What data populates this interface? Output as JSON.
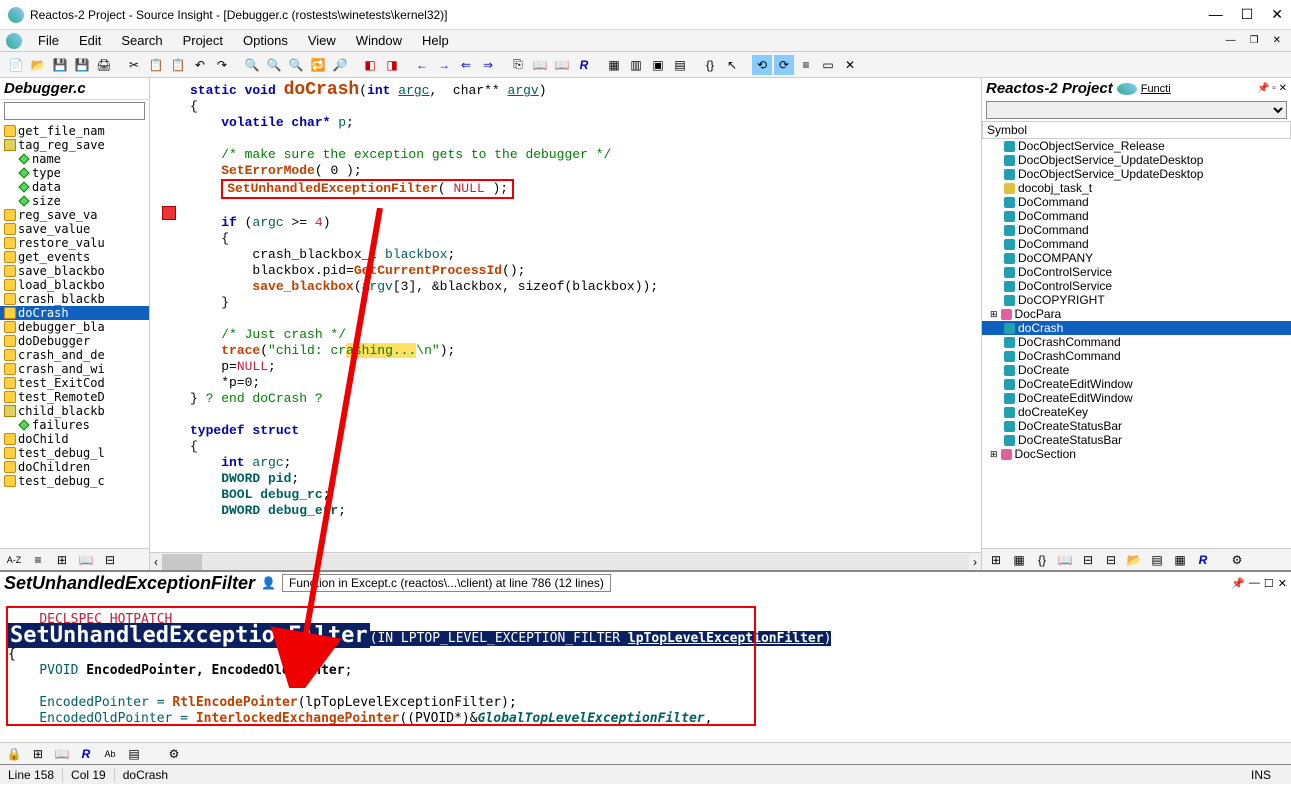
{
  "window": {
    "title": "Reactos-2 Project - Source Insight - [Debugger.c (rostests\\winetests\\kernel32)]"
  },
  "menu": {
    "items": [
      "File",
      "Edit",
      "Search",
      "Project",
      "Options",
      "View",
      "Window",
      "Help"
    ]
  },
  "left_pane": {
    "title": "Debugger.c",
    "symbols": [
      {
        "icon": "f",
        "indent": 0,
        "label": "get_file_nam"
      },
      {
        "icon": "s",
        "indent": 0,
        "label": "tag_reg_save"
      },
      {
        "icon": "m",
        "indent": 1,
        "label": "name"
      },
      {
        "icon": "m",
        "indent": 1,
        "label": "type"
      },
      {
        "icon": "m",
        "indent": 1,
        "label": "data"
      },
      {
        "icon": "m",
        "indent": 1,
        "label": "size"
      },
      {
        "icon": "f",
        "indent": 0,
        "label": "reg_save_va"
      },
      {
        "icon": "f",
        "indent": 0,
        "label": "save_value"
      },
      {
        "icon": "f",
        "indent": 0,
        "label": "restore_valu"
      },
      {
        "icon": "f",
        "indent": 0,
        "label": "get_events"
      },
      {
        "icon": "f",
        "indent": 0,
        "label": "save_blackbo"
      },
      {
        "icon": "f",
        "indent": 0,
        "label": "load_blackbo"
      },
      {
        "icon": "f",
        "indent": 0,
        "label": "crash_blackb"
      },
      {
        "icon": "f",
        "indent": 0,
        "label": "doCrash",
        "selected": true
      },
      {
        "icon": "f",
        "indent": 0,
        "label": "debugger_bla"
      },
      {
        "icon": "f",
        "indent": 0,
        "label": "doDebugger"
      },
      {
        "icon": "f",
        "indent": 0,
        "label": "crash_and_de"
      },
      {
        "icon": "f",
        "indent": 0,
        "label": "crash_and_wi"
      },
      {
        "icon": "f",
        "indent": 0,
        "label": "test_ExitCod"
      },
      {
        "icon": "f",
        "indent": 0,
        "label": "test_RemoteD"
      },
      {
        "icon": "s",
        "indent": 0,
        "label": "child_blackb"
      },
      {
        "icon": "m",
        "indent": 1,
        "label": "failures"
      },
      {
        "icon": "f",
        "indent": 0,
        "label": "doChild"
      },
      {
        "icon": "f",
        "indent": 0,
        "label": "test_debug_l"
      },
      {
        "icon": "f",
        "indent": 0,
        "label": "doChildren"
      },
      {
        "icon": "f",
        "indent": 0,
        "label": "test_debug_c"
      }
    ]
  },
  "editor": {
    "sig_prefix": "static void ",
    "fn_name": "doCrash",
    "sig_params_1": "int ",
    "sig_arg1": "argc",
    "sig_params_2": ",  char** ",
    "sig_arg2": "argv",
    "line_vol": "    volatile char* ",
    "var_p": "p",
    "cmt1": "    /* make sure the exception gets to the debugger */",
    "err1": "SetErrorMode",
    "err2": "( 0 );",
    "boxed_fn": "SetUnhandledExceptionFilter",
    "boxed_args": "( NULL );",
    "if_kw": "if",
    "if_cond_1": " (",
    "if_argc": "argc",
    "if_cond_2": " >= ",
    "if_num": "4",
    "if_cond_3": ")",
    "cb_type": "        crash_blackbox_t ",
    "cb_var": "blackbox",
    "bb_pid1": "        blackbox.pid=",
    "bb_pid_fn": "GetCurrentProcessId",
    "bb_pid2": "();",
    "sv_fn": "save_blackbox",
    "sv_args1": "(",
    "sv_argv": "argv",
    "sv_args2": "[3], &blackbox, sizeof(blackbox));",
    "cmt2": "    /* Just crash */",
    "tr_fn": "trace",
    "tr_args1": "(",
    "tr_str": "\"child: crashing...\\n\"",
    "tr_args2": ");",
    "pnull1": "    p=",
    "pnull2": "NULL",
    "pnull3": ";",
    "pderef": "    *p=0;",
    "end_cmt": " ? end doCrash ?",
    "td_kw": "typedef struct",
    "m1_kw": "    int ",
    "m1_var": "argc",
    "m2_kw": "    DWORD ",
    "m2_var": "pid",
    "m3_kw": "    BOOL ",
    "m3_var": "debug_rc",
    "m4_kw": "    DWORD ",
    "m4_var": "debug_err"
  },
  "right_pane": {
    "title": "Reactos-2 Project",
    "func_label": "Functi",
    "col_header": "Symbol",
    "items": [
      {
        "icon": "teal",
        "label": "DocObjectService_Release"
      },
      {
        "icon": "teal",
        "label": "DocObjectService_UpdateDesktop"
      },
      {
        "icon": "teal",
        "label": "DocObjectService_UpdateDesktop"
      },
      {
        "icon": "yellow",
        "label": "docobj_task_t"
      },
      {
        "icon": "teal",
        "label": "DoCommand"
      },
      {
        "icon": "teal",
        "label": "DoCommand"
      },
      {
        "icon": "teal",
        "label": "DoCommand"
      },
      {
        "icon": "teal",
        "label": "DoCommand"
      },
      {
        "icon": "teal",
        "label": "DoCOMPANY"
      },
      {
        "icon": "teal",
        "label": "DoControlService"
      },
      {
        "icon": "teal",
        "label": "DoControlService"
      },
      {
        "icon": "teal",
        "label": "DoCOPYRIGHT"
      },
      {
        "icon": "pink",
        "label": "DocPara",
        "expand": true
      },
      {
        "icon": "teal",
        "label": "doCrash",
        "selected": true
      },
      {
        "icon": "teal",
        "label": "DoCrashCommand"
      },
      {
        "icon": "teal",
        "label": "DoCrashCommand"
      },
      {
        "icon": "teal",
        "label": "DoCreate"
      },
      {
        "icon": "teal",
        "label": "DoCreateEditWindow"
      },
      {
        "icon": "teal",
        "label": "DoCreateEditWindow"
      },
      {
        "icon": "teal",
        "label": "doCreateKey"
      },
      {
        "icon": "teal",
        "label": "DoCreateStatusBar"
      },
      {
        "icon": "teal",
        "label": "DoCreateStatusBar"
      },
      {
        "icon": "pink",
        "label": "DocSection",
        "expand": true
      }
    ]
  },
  "bottom_pane": {
    "title": "SetUnhandledExceptionFilter",
    "info": "Function in Except.c (reactos\\...\\client) at line 786 (12 lines)",
    "decl": "DECLSPEC_HOTPATCH",
    "fn": "SetUnhandledExceptionFilter",
    "sig": "(IN LPTOP_LEVEL_EXCEPTION_FILTER ",
    "sig_param": "lpTopLevelExceptionFilter",
    "sig_end": ")",
    "body1_kw": "    PVOID ",
    "body1_vars": "EncodedPointer, EncodedOldPointer",
    "body2_1": "    EncodedPointer = ",
    "body2_fn": "RtlEncodePointer",
    "body2_2": "(lpTopLevelExceptionFilter);",
    "body3_1": "    EncodedOldPointer = ",
    "body3_fn": "InterlockedExchangePointer",
    "body3_2": "((PVOID*)&",
    "body3_var": "GlobalTopLevelExceptionFilter",
    "body3_3": ","
  },
  "statusbar": {
    "line": "Line 158",
    "col": "Col 19",
    "fn": "doCrash",
    "ins": "INS"
  }
}
